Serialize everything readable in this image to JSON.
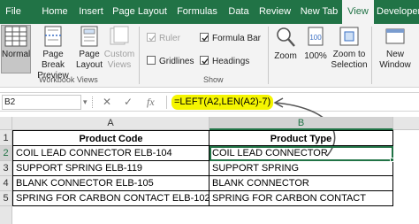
{
  "ribbon": {
    "tabs": [
      "File",
      "Home",
      "Insert",
      "Page Layout",
      "Formulas",
      "Data",
      "Review",
      "New Tab",
      "View",
      "Developer"
    ],
    "active_tab": "View",
    "groups": {
      "workbook_views": {
        "label": "Workbook Views",
        "normal": "Normal",
        "page_break_line1": "Page Break",
        "page_break_line2": "Preview",
        "page_layout_line1": "Page",
        "page_layout_line2": "Layout",
        "custom_views_line1": "Custom",
        "custom_views_line2": "Views"
      },
      "show": {
        "label": "Show",
        "ruler": "Ruler",
        "gridlines": "Gridlines",
        "formula_bar": "Formula Bar",
        "headings": "Headings"
      },
      "zoom": {
        "zoom": "Zoom",
        "hundred": "100%",
        "zoom_sel_line1": "Zoom to",
        "zoom_sel_line2": "Selection"
      },
      "window": {
        "new_window_line1": "New",
        "new_window_line2": "Window"
      }
    }
  },
  "formula_bar": {
    "name_box": "B2",
    "fx": "fx",
    "formula": "=LEFT(A2,LEN(A2)-7)"
  },
  "grid": {
    "columns": [
      "A",
      "B"
    ],
    "rows": [
      "1",
      "2",
      "3",
      "4",
      "5"
    ],
    "header": [
      "Product Code",
      "Product Type"
    ],
    "data": [
      [
        "COIL LEAD CONNECTOR ELB-104",
        "COIL LEAD CONNECTOR"
      ],
      [
        "SUPPORT SPRING ELB-119",
        "SUPPORT SPRING"
      ],
      [
        "BLANK CONNECTOR ELB-105",
        "BLANK CONNECTOR"
      ],
      [
        "SPRING FOR CARBON CONTACT ELB-102",
        "SPRING FOR CARBON CONTACT"
      ]
    ]
  },
  "colors": {
    "ribbon_green": "#217346",
    "highlight": "#f5f500",
    "annotation": "#555555"
  }
}
